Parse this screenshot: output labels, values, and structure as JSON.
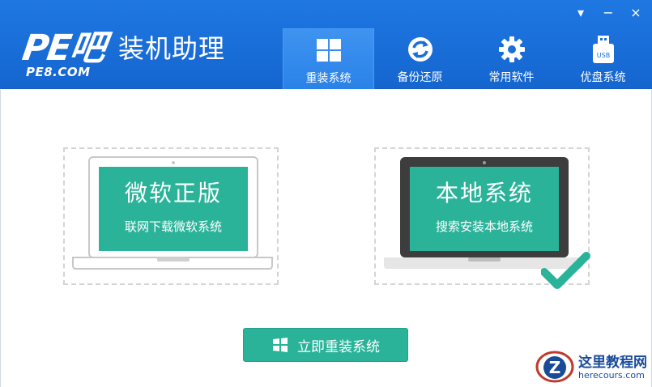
{
  "app": {
    "logo_mark": "PE吧",
    "title": "装机助理",
    "domain": "PE8.COM"
  },
  "window_controls": {
    "menu": "▾",
    "minimize": "−",
    "close": "×"
  },
  "nav": [
    {
      "label": "重装系统",
      "icon": "windows-icon",
      "active": true
    },
    {
      "label": "备份还原",
      "icon": "sync-icon",
      "active": false
    },
    {
      "label": "常用软件",
      "icon": "gear-icon",
      "active": false
    },
    {
      "label": "优盘系统",
      "icon": "usb-icon",
      "active": false
    }
  ],
  "cards": {
    "left": {
      "title": "微软正版",
      "subtitle": "联网下载微软系统",
      "selected": false
    },
    "right": {
      "title": "本地系统",
      "subtitle": "搜索安装本地系统",
      "selected": true
    }
  },
  "install_button": {
    "label": "立即重装系统"
  },
  "watermark": {
    "name": "这里教程网",
    "url": "herecours.com"
  },
  "colors": {
    "header_blue": "#1a6fd8",
    "accent_green": "#2bb39a",
    "laptop_frame_dark": "#3d3d3d",
    "laptop_frame_light": "#ffffff"
  }
}
